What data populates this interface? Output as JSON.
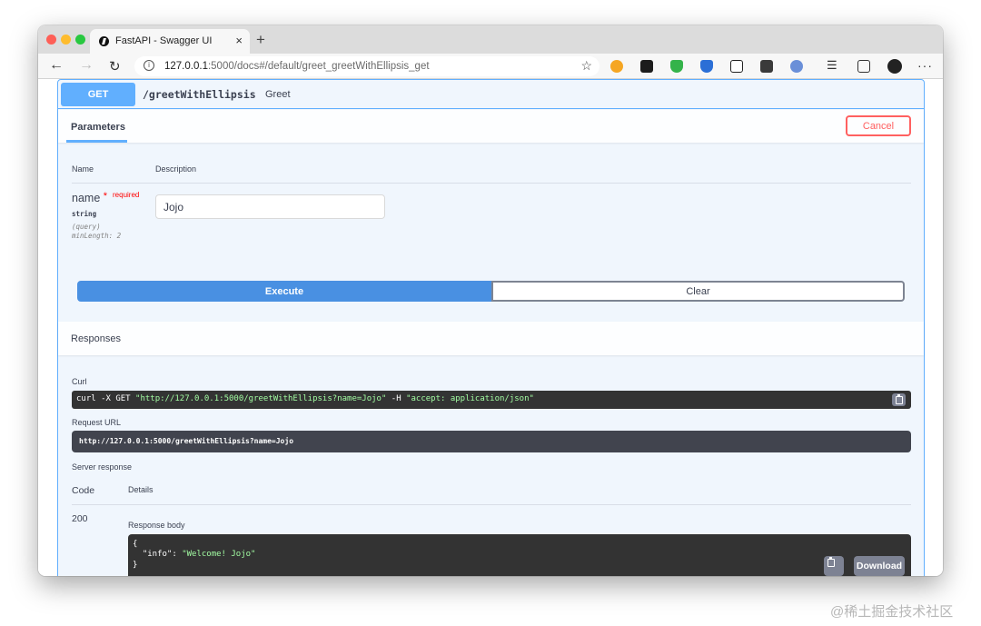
{
  "browser": {
    "tab_title": "FastAPI - Swagger UI",
    "tab_close": "×",
    "new_tab": "+",
    "url_host": "127.0.0.1",
    "url_rest": ":5000/docs#/default/greet_greetWithEllipsis_get",
    "menu": "···"
  },
  "operation": {
    "method": "GET",
    "path": "/greetWithEllipsis",
    "summary": "Greet"
  },
  "parameters": {
    "title": "Parameters",
    "cancel_label": "Cancel",
    "col_name": "Name",
    "col_description": "Description",
    "param": {
      "name": "name",
      "required_star": "*",
      "required_label": "required",
      "type": "string",
      "location": "(query)",
      "constraint": "minLength: 2",
      "value": "Jojo"
    },
    "execute_label": "Execute",
    "clear_label": "Clear"
  },
  "responses": {
    "title": "Responses",
    "curl_label": "Curl",
    "curl_prefix": "curl -X GET ",
    "curl_url": "\"http://127.0.0.1:5000/greetWithEllipsis?name=Jojo\"",
    "curl_flag": " -H  ",
    "curl_header": "\"accept: application/json\"",
    "request_url_label": "Request URL",
    "request_url": "http://127.0.0.1:5000/greetWithEllipsis?name=Jojo",
    "server_response_label": "Server response",
    "code_header": "Code",
    "details_header": "Details",
    "status_code": "200",
    "response_body_label": "Response body",
    "body_open": "{",
    "body_key": "  \"info\": ",
    "body_value": "\"Welcome! Jojo\"",
    "body_close": "}",
    "download_label": "Download"
  },
  "watermark": "@稀土掘金技术社区",
  "colors": {
    "get_blue": "#61affe",
    "execute_blue": "#4990e2",
    "cancel_red": "#ff6060",
    "code_bg": "#333333",
    "string_green": "#a2fca2"
  }
}
